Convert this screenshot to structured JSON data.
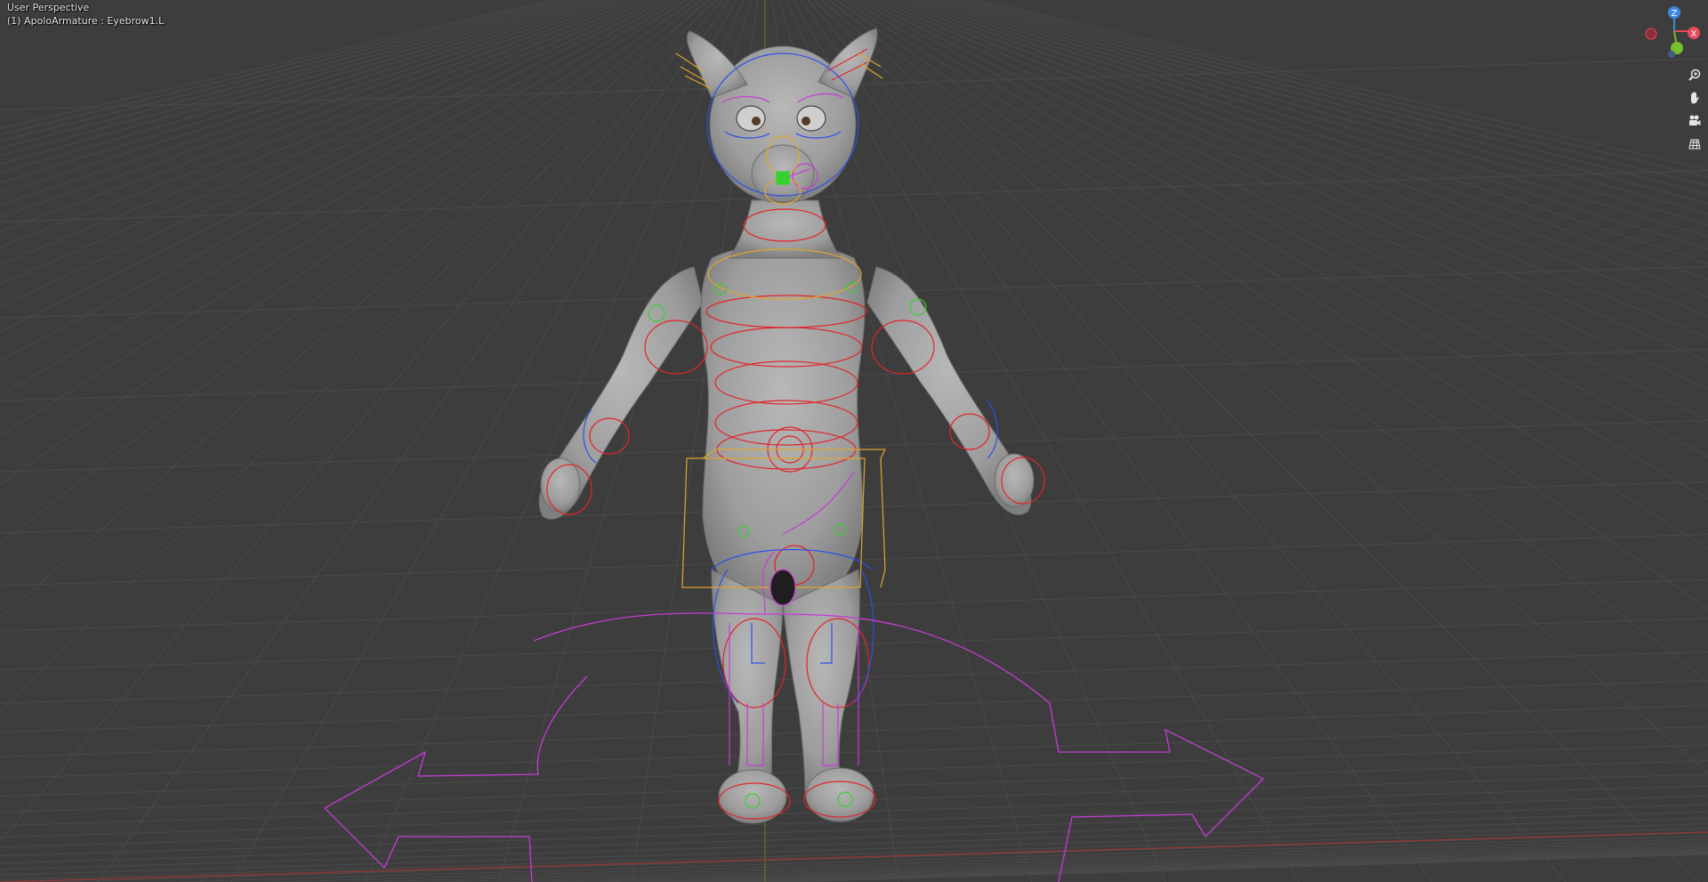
{
  "viewport": {
    "perspective_label": "User Perspective",
    "object_label": "(1) ApoloArmature : Eyebrow1.L"
  },
  "gizmo": {
    "z": "Z",
    "x": "X",
    "colors": {
      "x": "#e8485b",
      "y": "#77c02d",
      "z": "#3e88e0"
    }
  },
  "nav_buttons": [
    {
      "name": "zoom-icon"
    },
    {
      "name": "pan-hand-icon"
    },
    {
      "name": "camera-icon"
    },
    {
      "name": "grid-icon"
    }
  ],
  "bone_colors": {
    "red": "#e2242a",
    "blue": "#2e4fe8",
    "magenta": "#c63dd6",
    "yellow": "#e0a72a",
    "green": "#35d12e"
  }
}
